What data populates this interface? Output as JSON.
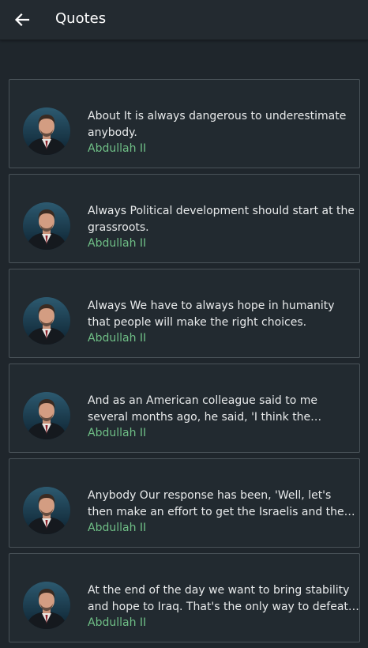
{
  "appbar": {
    "title": "Quotes",
    "back_icon": "arrow-left-icon"
  },
  "colors": {
    "background": "#1f262c",
    "card_border": "#4a5359",
    "author": "#6fbf86",
    "text": "#e8eaeb"
  },
  "quotes": [
    {
      "text": "About It is always dangerous to underestimate anybody.",
      "author": "Abdullah II"
    },
    {
      "text": "Always Political development should start at the grassroots.",
      "author": "Abdullah II"
    },
    {
      "text": "Always We have to always hope in humanity that people will make the right choices.",
      "author": "Abdullah II"
    },
    {
      "text": "And as an American colleague said to me several months ago, he said, 'I think the challenge in…",
      "author": "Abdullah II"
    },
    {
      "text": "Anybody Our response has been, 'Well, let's then make an effort to get the Israelis and the…",
      "author": "Abdullah II"
    },
    {
      "text": "At the end of the day we want to bring stability and hope to Iraq. That's the only way to defeat…",
      "author": "Abdullah II"
    }
  ]
}
